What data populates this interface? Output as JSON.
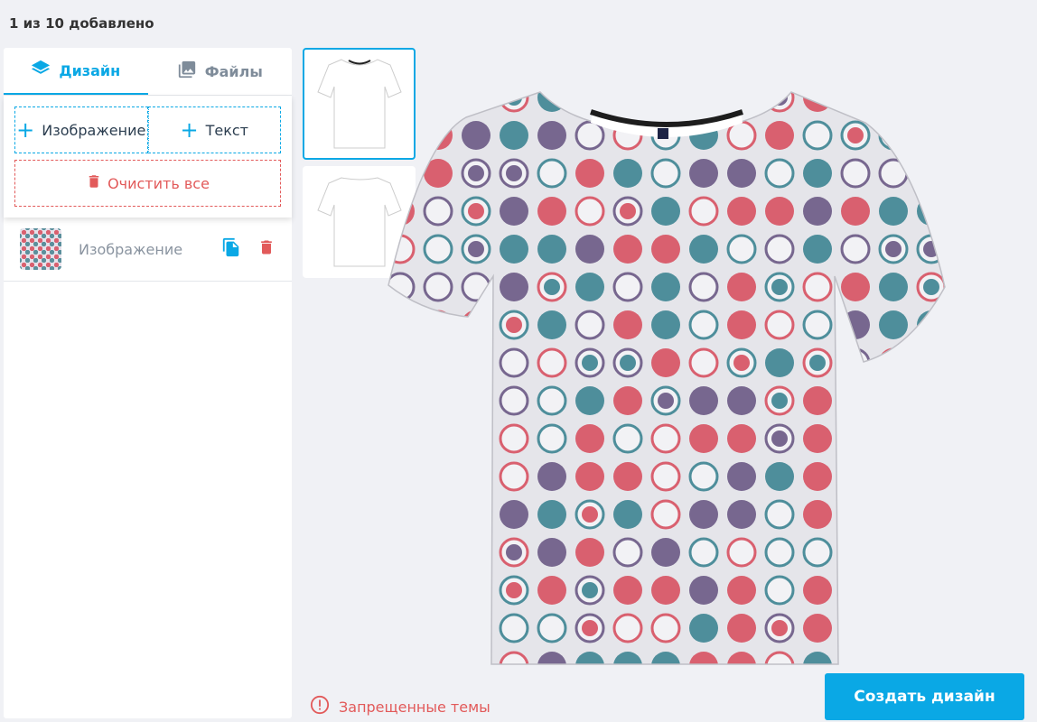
{
  "header": {
    "counter": "1 из 10 добавлено"
  },
  "tabs": [
    {
      "label": "Дизайн",
      "icon": "layers-icon",
      "active": true
    },
    {
      "label": "Файлы",
      "icon": "image-gallery-icon",
      "active": false
    }
  ],
  "tools": {
    "add_image": "Изображение",
    "add_text": "Текст",
    "clear_all": "Очистить все"
  },
  "layers": [
    {
      "name": "Изображение",
      "thumb": "pattern-thumbnail"
    }
  ],
  "views": [
    {
      "name": "front",
      "active": true
    },
    {
      "name": "back",
      "active": false
    }
  ],
  "footer": {
    "banned_topics": "Запрещенные темы",
    "create_button": "Создать дизайн"
  },
  "colors": {
    "accent": "#0aa8e5",
    "danger": "#e25a5a",
    "pattern_red": "#d9606f",
    "pattern_teal": "#4e8e9b",
    "pattern_purple": "#77678f",
    "shirt_base": "#e5e5ea"
  }
}
